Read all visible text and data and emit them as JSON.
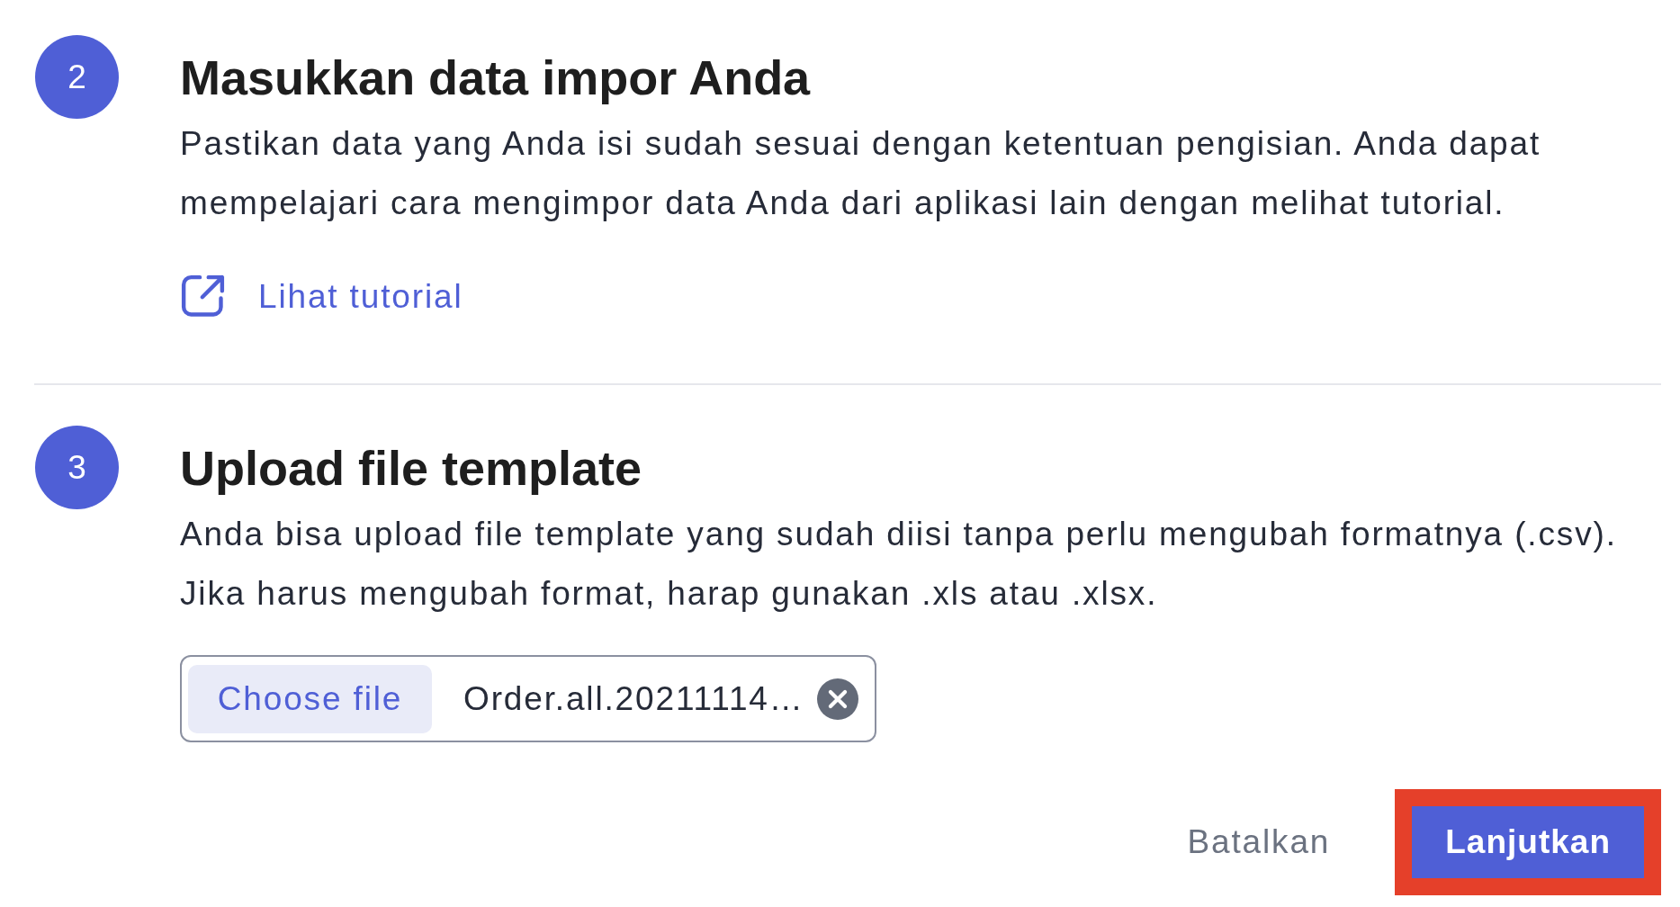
{
  "steps": [
    {
      "number": "2",
      "title": "Masukkan data impor Anda",
      "description": "Pastikan data yang Anda isi sudah sesuai dengan ketentuan pengisian. Anda dapat mempelajari cara mengimpor data Anda dari aplikasi lain dengan melihat tutorial.",
      "link": {
        "label": "Lihat tutorial"
      }
    },
    {
      "number": "3",
      "title": "Upload file template",
      "description": "Anda bisa upload file template yang sudah diisi tanpa perlu mengubah formatnya (.csv). Jika harus mengubah format, harap gunakan .xls atau .xlsx.",
      "file_input": {
        "button": "Choose file",
        "value": "Order.all.20211114…"
      }
    }
  ],
  "actions": [
    {
      "label": "Batalkan",
      "kind": "secondary",
      "highlighted": false
    },
    {
      "label": "Lanjutkan",
      "kind": "primary",
      "highlighted": true
    }
  ]
}
